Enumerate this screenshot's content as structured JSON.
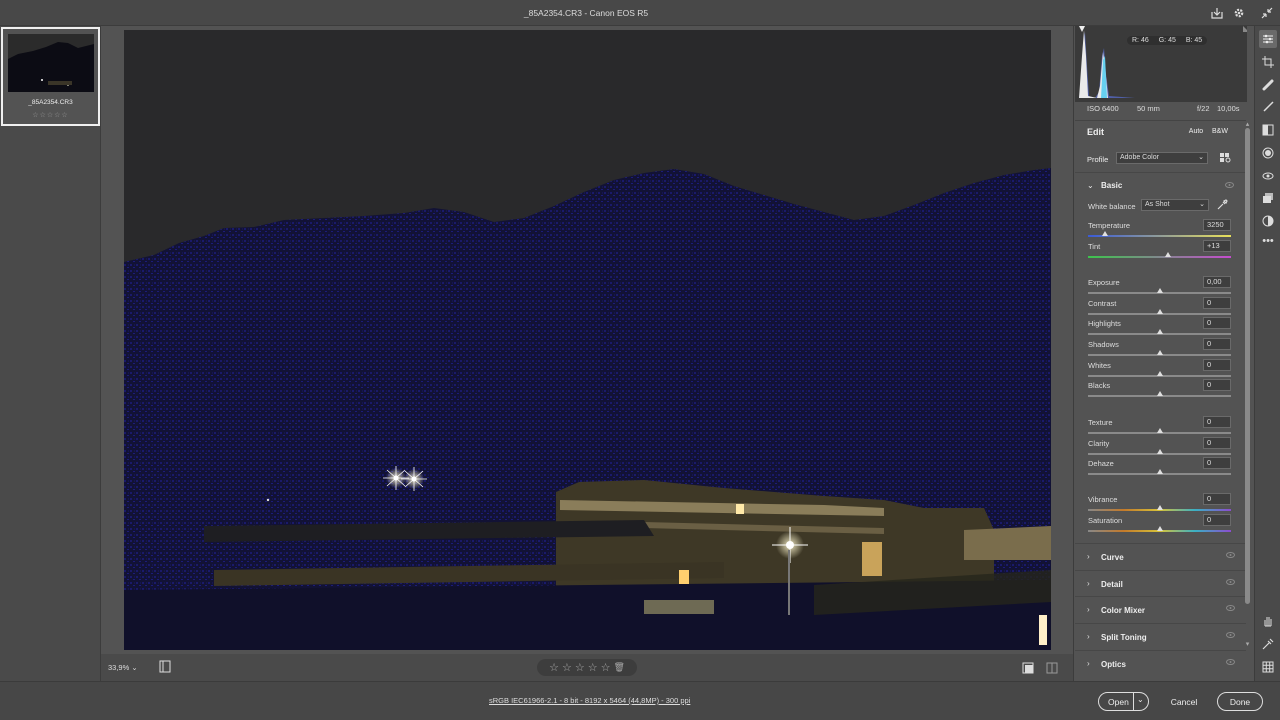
{
  "window": {
    "title": "_85A2354.CR3  -  Canon EOS R5"
  },
  "filmstrip": {
    "items": [
      {
        "name": "_85A2354.CR3",
        "stars": "☆☆☆☆☆"
      }
    ]
  },
  "bottombar": {
    "zoom": "33,9%",
    "rating_stars": [
      "☆",
      "☆",
      "☆",
      "☆",
      "☆"
    ]
  },
  "status": {
    "file_info": "sRGB IEC61966-2.1 - 8 bit - 8192 x 5464 (44,8MP) - 300 ppi",
    "open_label": "Open",
    "cancel_label": "Cancel",
    "done_label": "Done"
  },
  "histogram": {
    "r": "R: 46",
    "g": "G: 45",
    "b": "B: 45"
  },
  "camera": {
    "iso": "ISO 6400",
    "focal": "50 mm",
    "aperture": "f/22",
    "shutter": "10,00s"
  },
  "edit": {
    "title": "Edit",
    "auto_label": "Auto",
    "bw_label": "B&W",
    "profile_label": "Profile",
    "profile_value": "Adobe Color",
    "basic_label": "Basic",
    "wb_label": "White balance",
    "wb_value": "As Shot",
    "sliders": [
      {
        "label": "Temperature",
        "value": "3250",
        "pos": 0.12
      },
      {
        "label": "Tint",
        "value": "+13",
        "pos": 0.56
      },
      {
        "label": "Exposure",
        "value": "0,00",
        "pos": 0.5
      },
      {
        "label": "Contrast",
        "value": "0",
        "pos": 0.5
      },
      {
        "label": "Highlights",
        "value": "0",
        "pos": 0.5
      },
      {
        "label": "Shadows",
        "value": "0",
        "pos": 0.5
      },
      {
        "label": "Whites",
        "value": "0",
        "pos": 0.5
      },
      {
        "label": "Blacks",
        "value": "0",
        "pos": 0.5
      },
      {
        "label": "Texture",
        "value": "0",
        "pos": 0.5
      },
      {
        "label": "Clarity",
        "value": "0",
        "pos": 0.5
      },
      {
        "label": "Dehaze",
        "value": "0",
        "pos": 0.5
      },
      {
        "label": "Vibrance",
        "value": "0",
        "pos": 0.5
      },
      {
        "label": "Saturation",
        "value": "0",
        "pos": 0.5
      }
    ],
    "sections": [
      "Curve",
      "Detail",
      "Color Mixer",
      "Split Toning",
      "Optics"
    ]
  },
  "colors": {
    "accent": "#1473e6",
    "panel": "#535353",
    "sky": "#2a2a2c",
    "mountain": "#14143a"
  }
}
